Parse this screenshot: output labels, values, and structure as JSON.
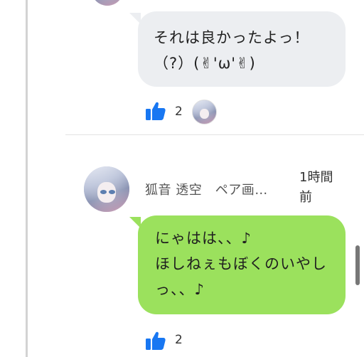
{
  "thread": {
    "previous_message": {
      "lines": [
        "それは良かったよっ！",
        "（?）(✌︎'ω'✌︎)"
      ],
      "likes": "2"
    },
    "comment": {
      "username": "狐音 透空　ペア画…",
      "timestamp": "1時間前",
      "lines": [
        "にゃはは、、♪",
        "ほしねぇもぼくのいやし",
        "っ、、♪"
      ],
      "likes": "2"
    }
  },
  "colors": {
    "accent_like": "#1877f2",
    "bubble_grey": "#eceef1",
    "bubble_green": "#9be15d"
  },
  "icons": {
    "like": "thumbs-up-icon"
  }
}
